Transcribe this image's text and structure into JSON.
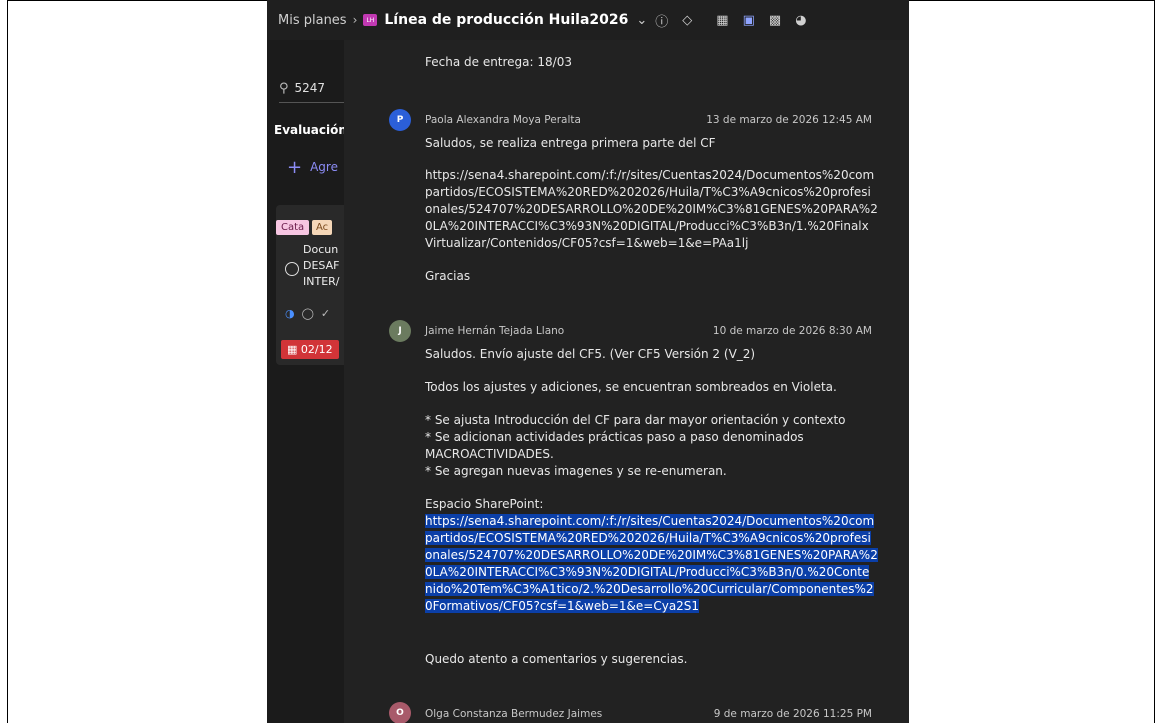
{
  "header": {
    "breadcrumb": "Mis planes",
    "plan_badge": "LH",
    "plan_title": "Línea de producción Huila2026"
  },
  "left_panel": {
    "search_value": "5247",
    "bucket_title": "Evaluación Ir",
    "add_task_label": "Agre",
    "tags": [
      "Cata",
      "Ac"
    ],
    "task_title": "Docun\nDESAF\nINTER/",
    "due_date": "02/12"
  },
  "comments": {
    "top_line": "Fecha de entrega: 18/03",
    "items": [
      {
        "author": "Paola Alexandra Moya Peralta",
        "avatar_initial": "P",
        "timestamp": "13 de marzo de 2026 12:45 AM",
        "lines": [
          "Saludos, se realiza entrega primera parte del CF",
          "https://sena4.sharepoint.com/:f:/r/sites/Cuentas2024/Documentos%20com",
          "partidos/ECOSISTEMA%20RED%202026/Huila/T%C3%A9cnicos%20profesi",
          "onales/524707%20DESARROLLO%20DE%20IM%C3%81GENES%20PARA%2",
          "0LA%20INTERACCI%C3%93N%20DIGITAL/Producci%C3%B3n/1.%20Finalx",
          "Virtualizar/Contenidos/CF05?csf=1&web=1&e=PAa1lj",
          "Gracias"
        ]
      },
      {
        "author": "Jaime Hernán Tejada Llano",
        "avatar_initial": "J",
        "timestamp": "10 de marzo de 2026 8:30 AM",
        "lines": [
          "Saludos. Envío ajuste del CF5. (Ver CF5 Versión 2 (V_2)",
          "Todos los ajustes y adiciones, se encuentran sombreados en Violeta.",
          "* Se ajusta Introducción del CF para dar mayor orientación y contexto",
          "* Se adicionan actividades prácticas paso a paso denominados",
          "MACROACTIVIDADES.",
          "* Se agregan nuevas imagenes y se re-enumeran.",
          "Espacio SharePoint:",
          "https://sena4.sharepoint.com/:f:/r/sites/Cuentas2024/Documentos%20com",
          "partidos/ECOSISTEMA%20RED%202026/Huila/T%C3%A9cnicos%20profesi",
          "onales/524707%20DESARROLLO%20DE%20IM%C3%81GENES%20PARA%2",
          "0LA%20INTERACCI%C3%93N%20DIGITAL/Producci%C3%B3n/0.%20Conte",
          "nido%20Tem%C3%A1tico/2.%20Desarrollo%20Curricular/Componentes%2",
          "0Formativos/CF05?csf=1&web=1&e=Cya2S1",
          "Quedo atento a comentarios y sugerencias."
        ]
      },
      {
        "author": "Olga Constanza Bermudez Jaimes",
        "avatar_initial": "O",
        "timestamp": "9 de marzo de 2026 11:25 PM"
      }
    ]
  }
}
